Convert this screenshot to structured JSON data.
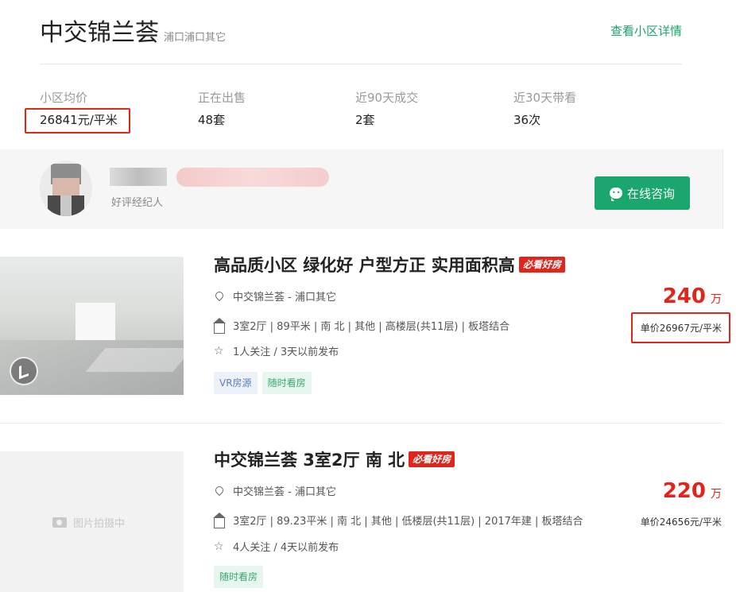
{
  "community": {
    "name": "中交锦兰荟",
    "location": "浦口浦口其它",
    "detail_link": "查看小区详情",
    "stats": [
      {
        "label": "小区均价",
        "value": "26841元/平米"
      },
      {
        "label": "正在出售",
        "value": "48套"
      },
      {
        "label": "近90天成交",
        "value": "2套"
      },
      {
        "label": "近30天带看",
        "value": "36次"
      }
    ]
  },
  "agent": {
    "role": "好评经纪人",
    "consult_label": "在线咨询"
  },
  "listings": [
    {
      "title": "高品质小区 绿化好 户型方正 实用面积高",
      "badge": "必看好房",
      "location": "中交锦兰荟 - 浦口其它",
      "info": "3室2厅 | 89平米 | 南 北 | 其他 | 高楼层(共11层) | 板塔结合",
      "follow": "1人关注 / 3天以前发布",
      "tags": [
        "VR房源",
        "随时看房"
      ],
      "price": "240",
      "price_unit": "万",
      "unit_price": "单价26967元/平米"
    },
    {
      "title": "中交锦兰荟 3室2厅 南 北",
      "badge": "必看好房",
      "location": "中交锦兰荟 - 浦口其它",
      "info": "3室2厅 | 89.23平米 | 南 北 | 其他 | 低楼层(共11层) | 2017年建 | 板塔结合",
      "follow": "4人关注 / 4天以前发布",
      "tags": [
        "随时看房"
      ],
      "price": "220",
      "price_unit": "万",
      "unit_price": "单价24656元/平米",
      "photo_placeholder": "图片拍摄中"
    }
  ],
  "colors": {
    "accent_green": "#1aa66c",
    "price_red": "#e1251b"
  }
}
